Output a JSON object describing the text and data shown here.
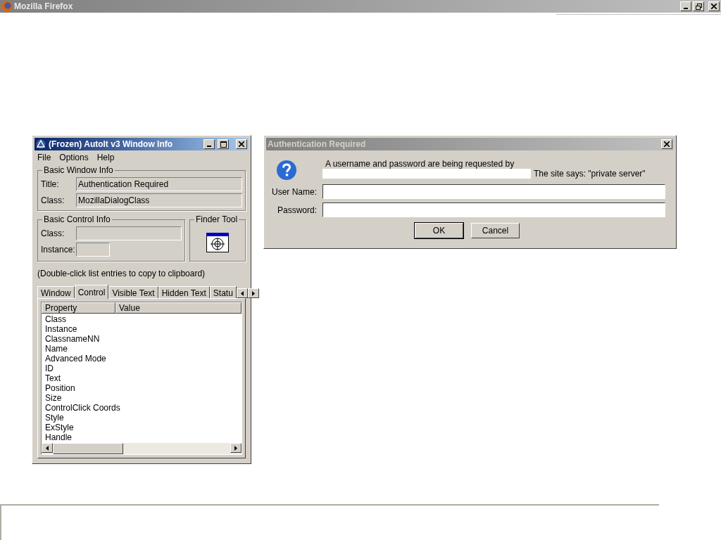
{
  "browser": {
    "title": "Mozilla Firefox"
  },
  "info_window": {
    "title": "(Frozen) AutoIt v3 Window Info",
    "menu": [
      "File",
      "Options",
      "Help"
    ],
    "window_group": {
      "title": "Basic Window Info",
      "fields": [
        {
          "label": "Title:",
          "value": "Authentication Required"
        },
        {
          "label": "Class:",
          "value": "MozillaDialogClass"
        }
      ]
    },
    "control_group": {
      "title": "Basic Control Info",
      "fields": [
        {
          "label": "Class:"
        },
        {
          "label": "Instance:"
        }
      ]
    },
    "finder": {
      "title": "Finder Tool"
    },
    "hint": "(Double-click list entries to copy to clipboard)",
    "tabs": [
      {
        "label": "Window",
        "selected": false
      },
      {
        "label": "Control",
        "selected": true
      },
      {
        "label": "Visible Text",
        "selected": false
      },
      {
        "label": "Hidden Text",
        "selected": false
      },
      {
        "label": "Statu",
        "selected": false
      }
    ],
    "columns": [
      "Property",
      "Value"
    ],
    "rows": [
      "Class",
      "Instance",
      "ClassnameNN",
      "Name",
      "Advanced Mode",
      "ID",
      "Text",
      "Position",
      "Size",
      "ControlClick Coords",
      "Style",
      "ExStyle",
      "Handle"
    ]
  },
  "auth_dialog": {
    "title": "Authentication Required",
    "message": "A username and password are being requested by",
    "site_says": "The site says: \"private server\"",
    "fields": [
      {
        "label": "User Name:"
      },
      {
        "label": "Password:"
      }
    ],
    "buttons": [
      "OK",
      "Cancel"
    ]
  }
}
